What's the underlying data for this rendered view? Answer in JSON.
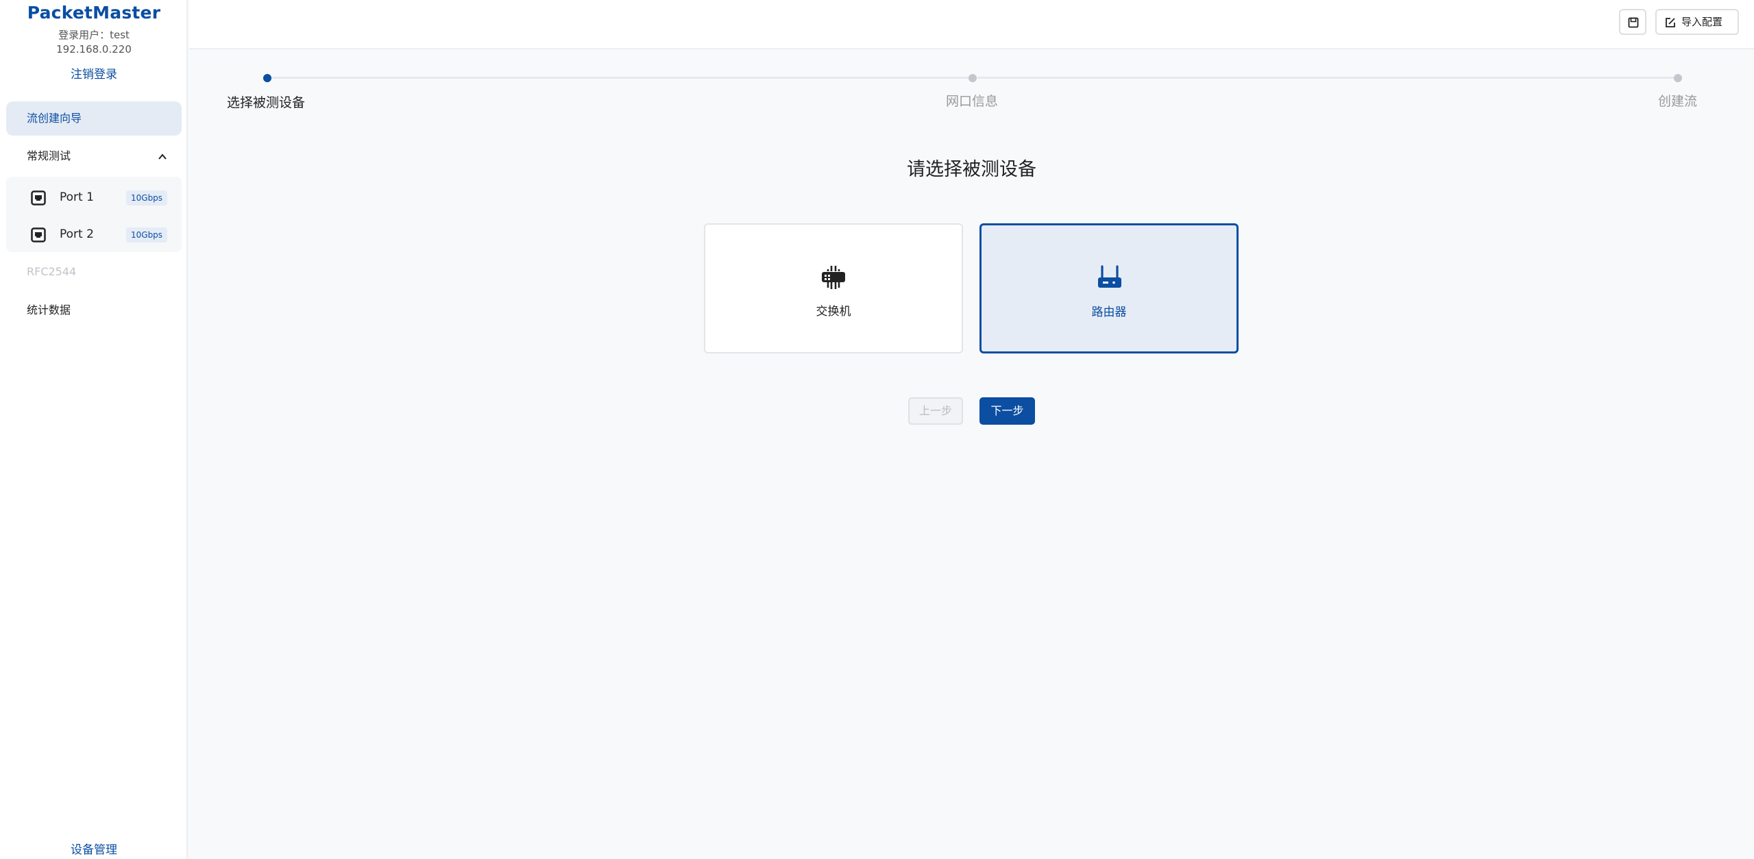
{
  "sidebar": {
    "brand": "PacketMaster",
    "user_line": "登录用户：test",
    "ip": "192.168.0.220",
    "logout": "注销登录",
    "items": [
      {
        "label": "流创建向导"
      },
      {
        "label": "常规测试"
      },
      {
        "label": "RFC2544"
      },
      {
        "label": "统计数据"
      }
    ],
    "ports": [
      {
        "label": "Port 1",
        "speed": "10Gbps"
      },
      {
        "label": "Port 2",
        "speed": "10Gbps"
      }
    ],
    "footer": "设备管理"
  },
  "header": {
    "import_label": "导入配置"
  },
  "steps": [
    {
      "label": "选择被测设备"
    },
    {
      "label": "网口信息"
    },
    {
      "label": "创建流"
    }
  ],
  "main": {
    "title": "请选择被测设备",
    "cards": [
      {
        "label": "交换机",
        "icon": "switch-icon"
      },
      {
        "label": "路由器",
        "icon": "router-icon"
      }
    ],
    "prev_label": "上一步",
    "next_label": "下一步"
  },
  "colors": {
    "accent": "#0b4ea2",
    "selected_bg": "#e6ecf5"
  }
}
